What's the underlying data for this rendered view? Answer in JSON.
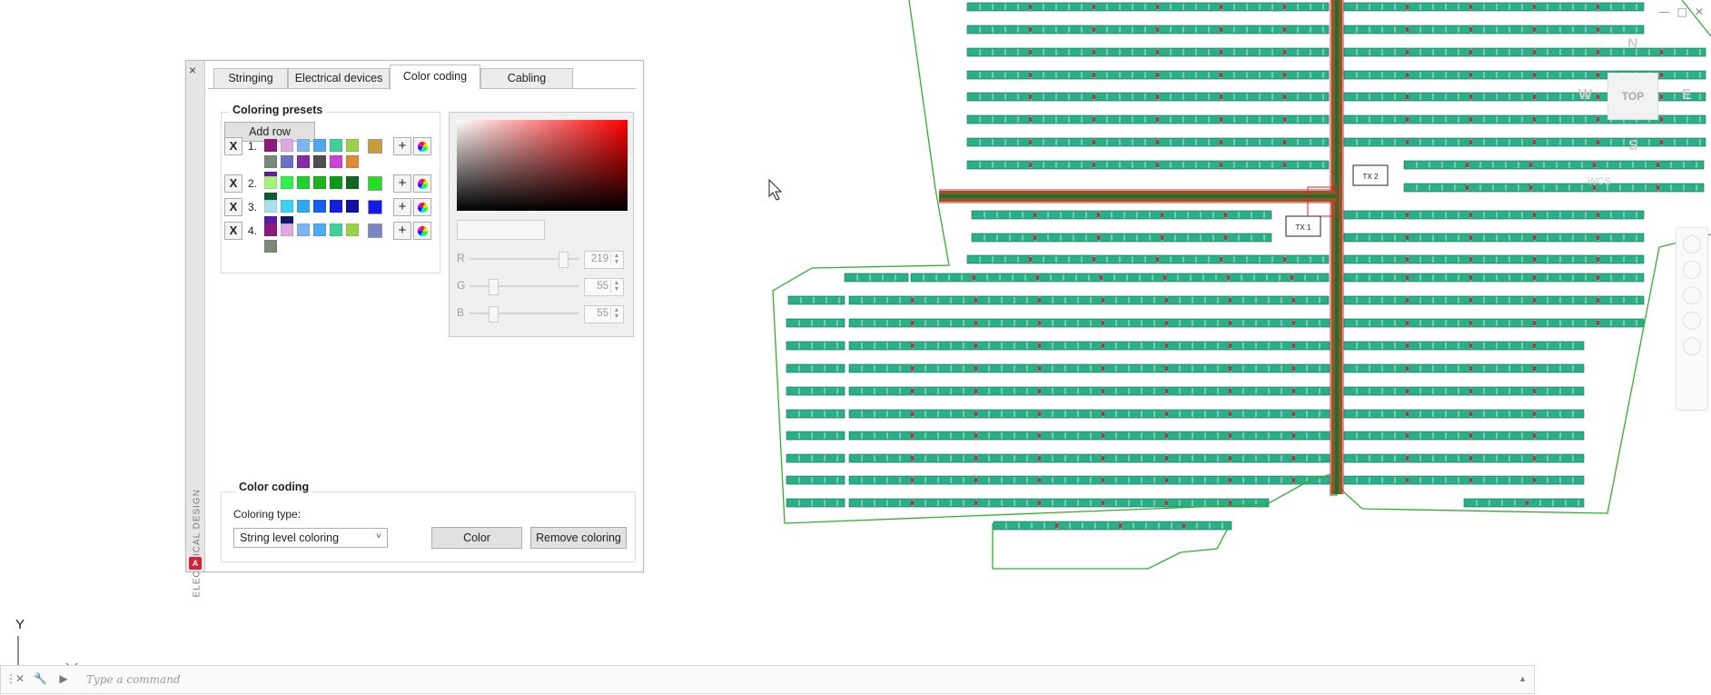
{
  "window_controls": {
    "minimize": "—",
    "restore": "□",
    "close": "✕"
  },
  "viewcube": {
    "top": "TOP",
    "north": "N",
    "south": "S",
    "west": "W",
    "east": "E",
    "wcs": "WCS"
  },
  "drawing": {
    "tx1_label": "TX 1",
    "tx2_label": "TX 2",
    "ucs_y": "Y"
  },
  "palette": {
    "title": "ELECTRICAL DESIGN",
    "close": "×",
    "logo": "A",
    "tabs": [
      "Stringing",
      "Electrical devices",
      "Color coding",
      "Cabling"
    ],
    "active_tab": "Color coding",
    "presets": {
      "title": "Coloring presets",
      "add_row": "Add row",
      "remove": "X",
      "add": "+",
      "rows": [
        {
          "num": "1.",
          "selected": "#c79e36",
          "colors": [
            "#8b1a7a",
            "#e0a8e0",
            "#80b4f0",
            "#50a8f0",
            "#40d09a",
            "#9ad04a",
            "#7a8a78",
            "#6a72c8",
            "#8a2aa8",
            "#505050",
            "#d040d8",
            "#e08a30",
            "#6a1a98"
          ]
        },
        {
          "num": "2.",
          "selected": "#22e022",
          "colors": [
            "#a8f080",
            "#30f050",
            "#20d030",
            "#20b020",
            "#109818",
            "#106820",
            "#105a30"
          ]
        },
        {
          "num": "3.",
          "selected": "#1418e8",
          "colors": [
            "#a8e0f0",
            "#40d0f0",
            "#30a8f0",
            "#1460f0",
            "#1420e0",
            "#1410a0",
            "#5a1aa8",
            "#101870"
          ]
        },
        {
          "num": "4.",
          "selected": "#7a84c8",
          "colors": [
            "#8b1a7a",
            "#e0a8e0",
            "#80b4f0",
            "#50a8f0",
            "#40d09a",
            "#9ad04a",
            "#7a8a78"
          ]
        }
      ]
    },
    "picker": {
      "r_label": "R",
      "g_label": "G",
      "b_label": "B",
      "r": "219",
      "g": "55",
      "b": "55",
      "r_frac": 0.86,
      "g_frac": 0.22,
      "b_frac": 0.22,
      "spin_up": "▲",
      "spin_down": "▼"
    },
    "coding": {
      "title": "Color coding",
      "type_label": "Coloring type:",
      "type_value": "String level coloring",
      "combo_arrow": "˅",
      "color_button": "Color",
      "remove_button": "Remove coloring"
    }
  },
  "command": {
    "placeholder": "Type a command",
    "expand": "▲"
  }
}
